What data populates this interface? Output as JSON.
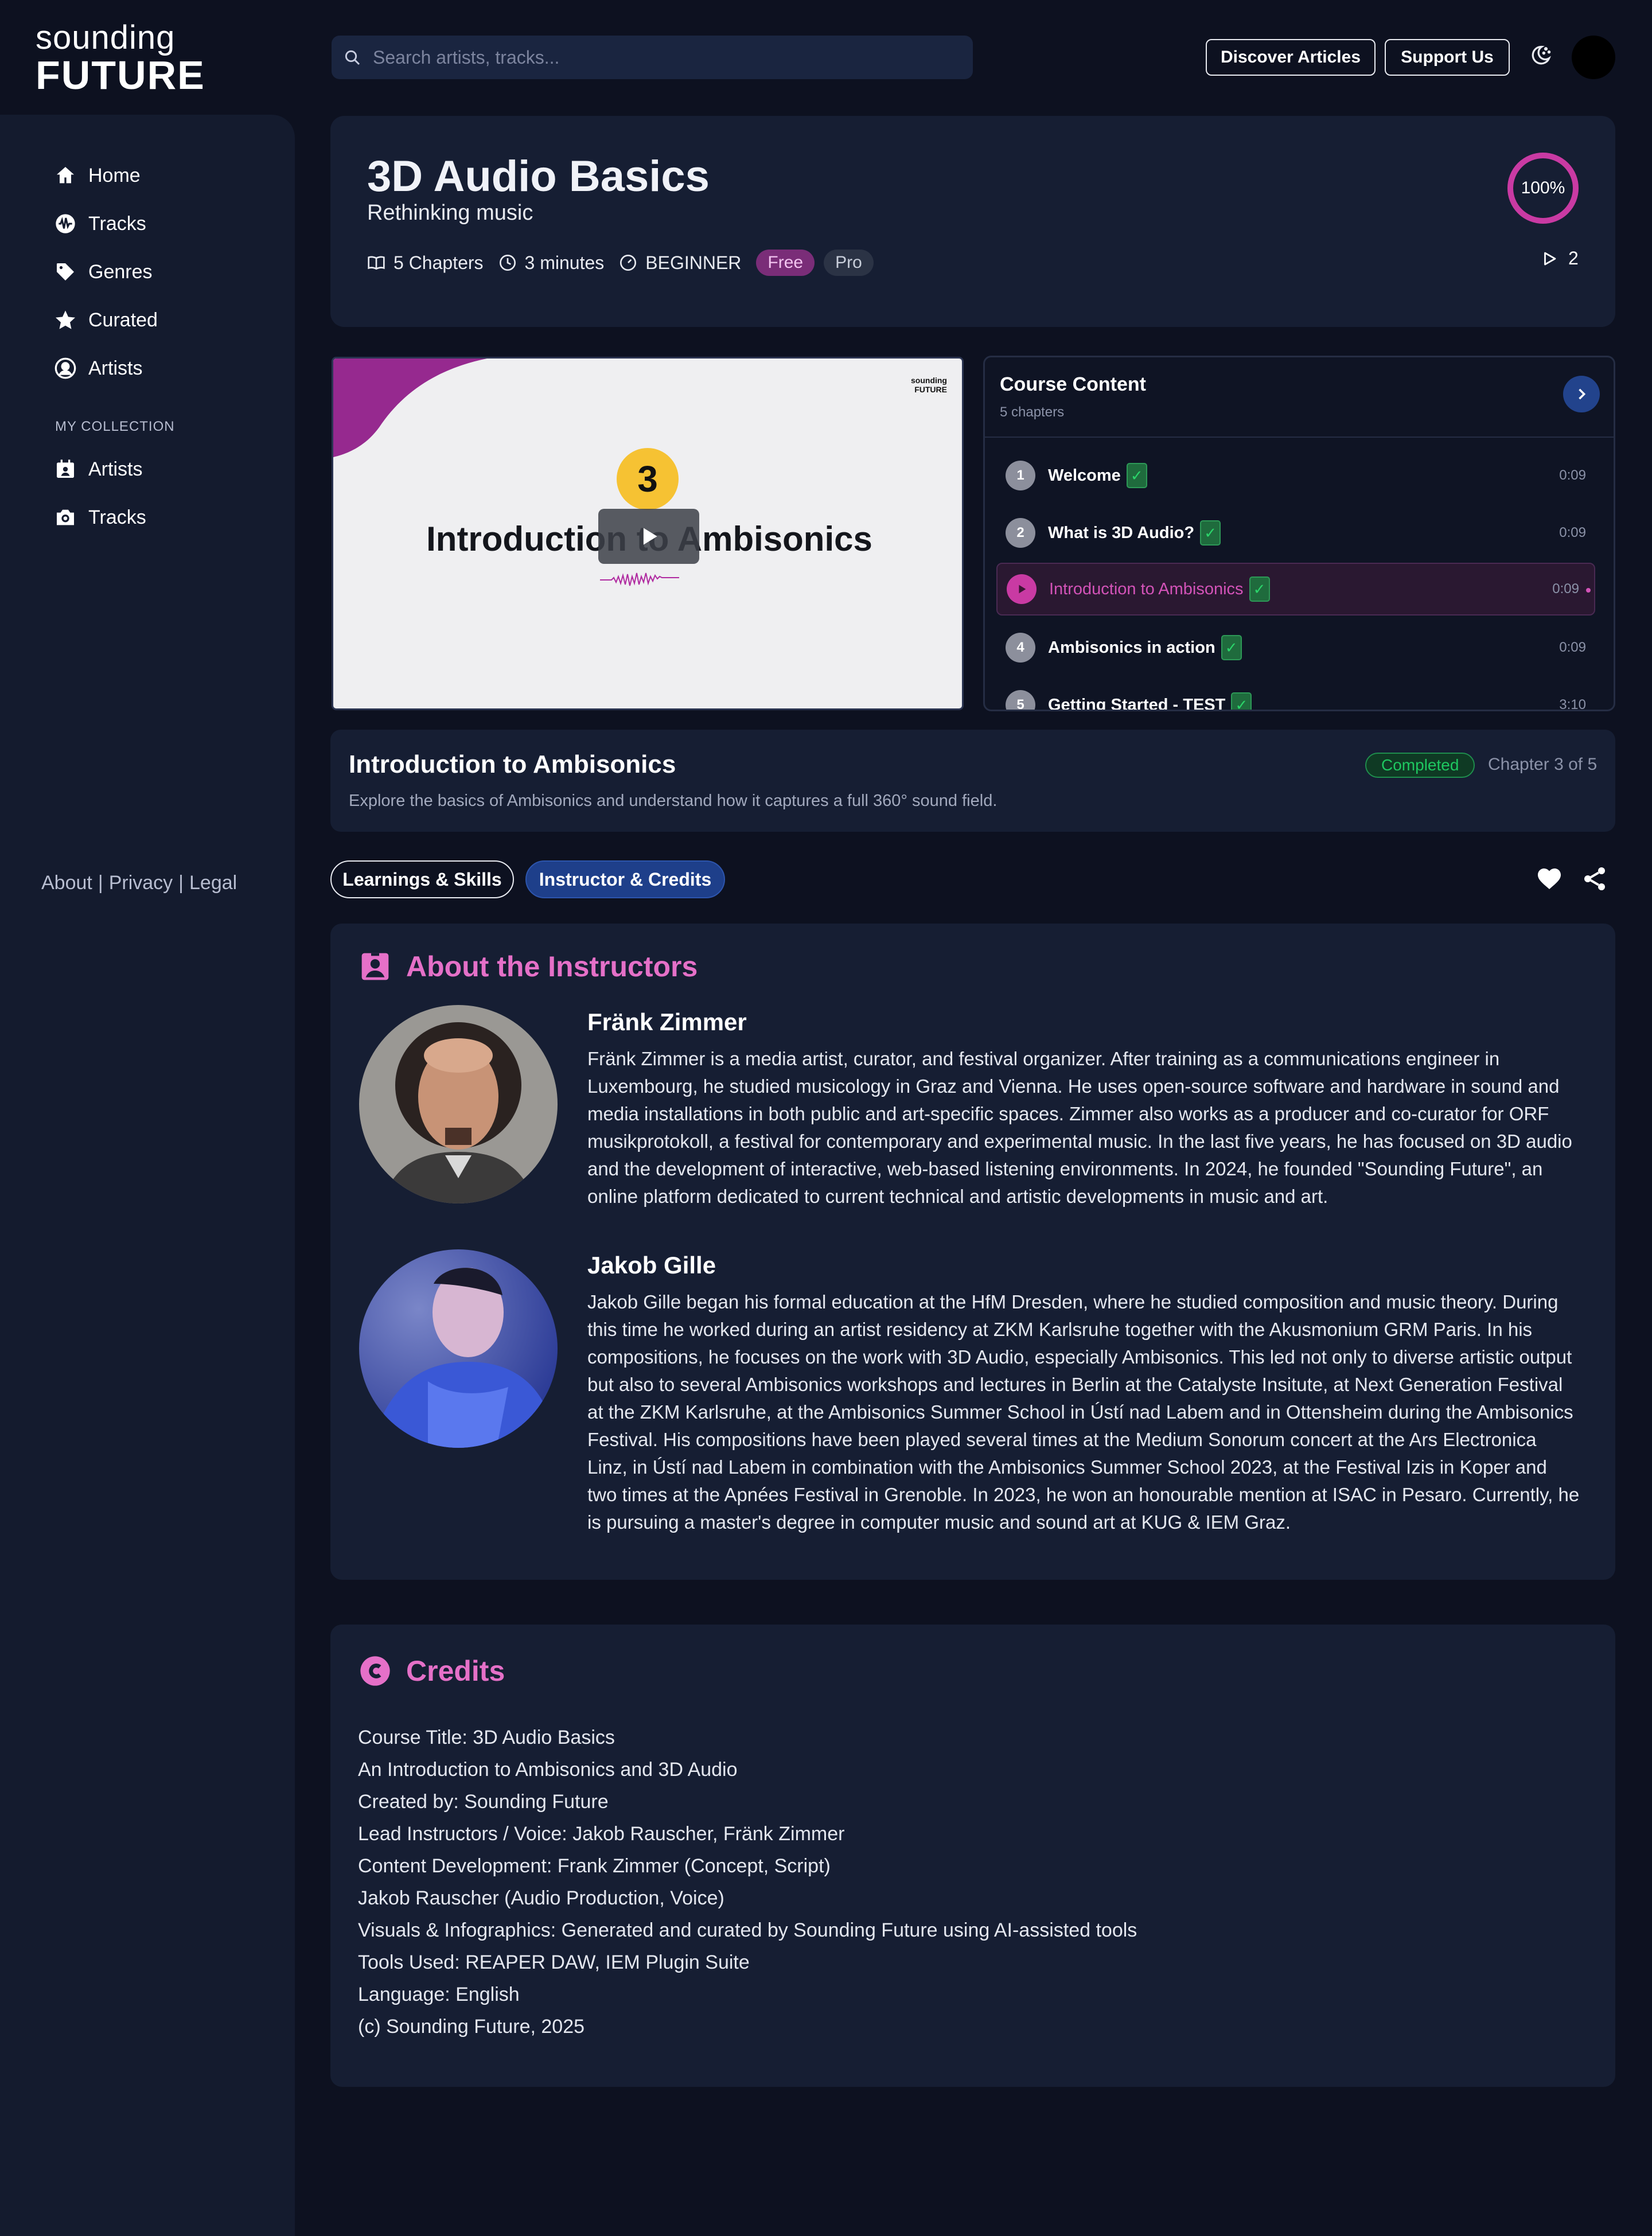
{
  "brand": {
    "line1": "sounding",
    "line2": "FUTURE"
  },
  "search": {
    "placeholder": "Search artists, tracks..."
  },
  "header_buttons": {
    "discover": "Discover Articles",
    "support": "Support Us"
  },
  "sidebar": {
    "items": [
      {
        "label": "Home",
        "icon": "home-icon"
      },
      {
        "label": "Tracks",
        "icon": "waveform-icon"
      },
      {
        "label": "Genres",
        "icon": "tag-icon"
      },
      {
        "label": "Curated",
        "icon": "star-icon"
      },
      {
        "label": "Artists",
        "icon": "user-circle-icon"
      }
    ],
    "collection_heading": "MY COLLECTION",
    "collection_items": [
      {
        "label": "Artists",
        "icon": "calendar-user-icon"
      },
      {
        "label": "Tracks",
        "icon": "camera-icon"
      }
    ],
    "footer": {
      "about": "About",
      "privacy": "Privacy",
      "legal": "Legal",
      "separator": "|"
    }
  },
  "course": {
    "title": "3D Audio Basics",
    "subtitle": "Rethinking music",
    "chapters_meta": "5 Chapters",
    "duration": "3 minutes",
    "level": "BEGINNER",
    "badge_free": "Free",
    "badge_pro": "Pro",
    "progress_label": "100%",
    "progress_value": 1.0,
    "plays": "2"
  },
  "video": {
    "mini_logo_1": "sounding",
    "mini_logo_2": "FUTURE",
    "chapter_number": "3",
    "slide_title": "Introduction to Ambisonics"
  },
  "course_content": {
    "title": "Course Content",
    "subtitle": "5 chapters",
    "check_mark": "✓",
    "chapters": [
      {
        "num": "1",
        "title": "Welcome",
        "time": "0:09"
      },
      {
        "num": "2",
        "title": "What is 3D Audio?",
        "time": "0:09"
      },
      {
        "num": "",
        "title": "Introduction to Ambisonics",
        "time": "0:09"
      },
      {
        "num": "4",
        "title": "Ambisonics in action",
        "time": "0:09"
      },
      {
        "num": "5",
        "title": "Getting Started - TEST",
        "time": "3:10"
      }
    ]
  },
  "chapter_info": {
    "title": "Introduction to Ambisonics",
    "description": "Explore the basics of Ambisonics and understand how it captures a full 360° sound field.",
    "status": "Completed",
    "position": "Chapter 3 of 5"
  },
  "tabs": {
    "learnings": "Learnings & Skills",
    "instructor": "Instructor & Credits"
  },
  "instructors": {
    "heading": "About the Instructors",
    "people": [
      {
        "name": "Fränk Zimmer",
        "bio": "Fränk Zimmer is a media artist, curator, and festival organizer. After training as a communications engineer in Luxembourg, he studied musicology in Graz and Vienna. He uses open-source software and hardware in sound and media installations in both public and art-specific spaces. Zimmer also works as a producer and co-curator for ORF musikprotokoll, a festival for contemporary and experimental music. In the last five years, he has focused on 3D audio and the development of interactive, web-based listening environments. In 2024, he founded \"Sounding Future\", an online platform dedicated to current technical and artistic developments in music and art."
      },
      {
        "name": "Jakob Gille",
        "bio": "Jakob Gille began his formal education at the HfM Dresden, where he studied composition and music theory. During this time he worked during an artist residency at ZKM Karlsruhe together with the Akusmonium GRM Paris. In his compositions, he focuses on the work with 3D Audio, especially Ambisonics. This led not only to diverse artistic output but also to several Ambisonics workshops and lectures in Berlin at the Catalyste Insitute, at Next Generation Festival at the ZKM Karlsruhe, at the Ambisonics Summer School in Ústí nad Labem and in Ottensheim during the Ambisonics Festival. His compositions have been played several times at the Medium Sonorum concert at the Ars Electronica Linz, in Ústí nad Labem in combination with the Ambisonics Summer School 2023, at the Festival Izis in Koper and two times at the Apnées Festival in Grenoble. In 2023, he won an honourable mention at ISAC in Pesaro. Currently, he is pursuing a master's degree in computer music and sound art at KUG & IEM Graz."
      }
    ]
  },
  "credits": {
    "heading": "Credits",
    "lines": [
      "Course Title: 3D Audio Basics",
      "An Introduction to Ambisonics and 3D Audio",
      "Created by: Sounding Future",
      "Lead Instructors / Voice: Jakob Rauscher, Fränk Zimmer",
      "Content Development: Frank Zimmer (Concept, Script)",
      "Jakob Rauscher (Audio Production, Voice)",
      "Visuals & Infographics: Generated and curated by Sounding Future using AI-assisted tools",
      "Tools Used: REAPER DAW, IEM Plugin Suite",
      "Language: English",
      "(c) Sounding Future, 2025"
    ]
  },
  "colors": {
    "background": "#0d1120",
    "panel": "#161e33",
    "accent_pink": "#e570c8",
    "accent_blue": "#1e3f8a",
    "success_green": "#1ec760"
  }
}
